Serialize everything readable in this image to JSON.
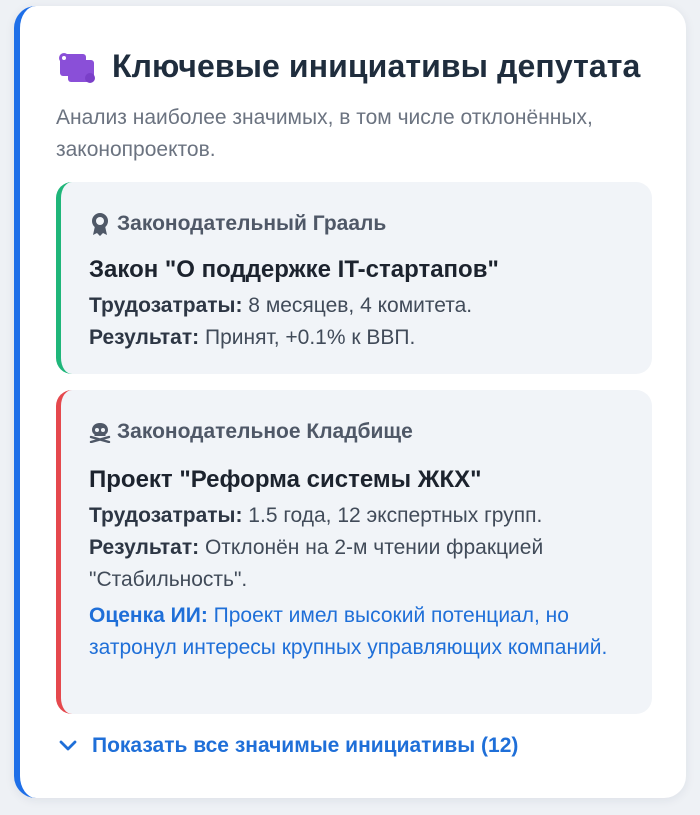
{
  "header": {
    "title": "Ключевые инициативы депутата",
    "subtitle": "Анализ наиболее значимых, в том числе отклонённых, законопроектов.",
    "icon": "scroll-icon"
  },
  "colors": {
    "accent": "#1e6fe8",
    "success": "#1fb67a",
    "danger": "#e5484d",
    "scroll_icon": "#8a4fd8",
    "link": "#1f6fd8"
  },
  "initiatives": [
    {
      "kind_icon": "award-icon",
      "kind": "Законодательный Грааль",
      "title": "Закон \"О поддержке IT-стартапов\"",
      "effort_label": "Трудозатраты:",
      "effort_value": " 8 месяцев, 4 комитета.",
      "result_label": "Результат:",
      "result_value": " Принят, +0.1% к ВВП."
    },
    {
      "kind_icon": "skull-crossbones-icon",
      "kind": "Законодательное Кладбище",
      "title": "Проект \"Реформа системы ЖКХ\"",
      "effort_label": "Трудозатраты:",
      "effort_value": " 1.5 года, 12 экспертных групп.",
      "result_label": "Результат:",
      "result_value": " Отклонён на 2-м чтении фракцией \"Стабильность\".",
      "ai_label": "Оценка ИИ:",
      "ai_value": " Проект имел высокий потенциал, но затронул интересы крупных управляющих компаний."
    }
  ],
  "show_all": {
    "label": "Показать все значимые инициативы (12)",
    "icon": "chevron-down-icon"
  }
}
